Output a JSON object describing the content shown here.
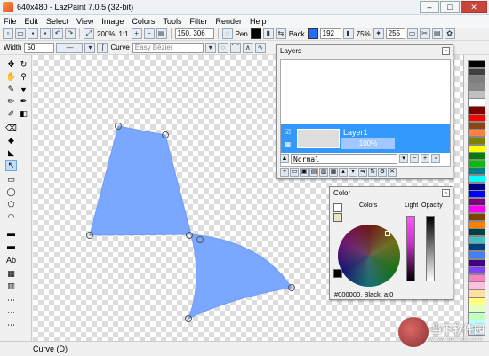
{
  "window": {
    "title": "640x480 - LazPaint 7.0.5 (32-bit)"
  },
  "menu": [
    "File",
    "Edit",
    "Select",
    "View",
    "Image",
    "Colors",
    "Tools",
    "Filter",
    "Render",
    "Help"
  ],
  "toolbar1": {
    "zoom": "200%",
    "zoom_reset": "1:1",
    "coords": "150, 306",
    "pen_label": "Pen",
    "back_label": "Back",
    "back_value": "192",
    "percent": "75%",
    "tolerance_value": "255"
  },
  "toolbar2": {
    "width_label": "Width",
    "width_value": "50",
    "curve_label": "Curve",
    "spline_style": "Easy Bézier"
  },
  "colors": {
    "pen": "#000000",
    "back": "#1e6fff",
    "shape_fill": "#7aa7ff"
  },
  "layers": {
    "title": "Layers",
    "layer_name": "Layer1",
    "layer_opacity": "100%",
    "blend_mode": "Normal"
  },
  "color_panel": {
    "title": "Color",
    "colors_label": "Colors",
    "light_label": "Light",
    "opacity_label": "Opacity",
    "readout": "#000000, Black, a:0"
  },
  "palette": [
    "#000000",
    "#404040",
    "#7f7f7f",
    "#888888",
    "#c0c0c0",
    "#ffffff",
    "#800000",
    "#ff0000",
    "#8b4513",
    "#ff8040",
    "#808000",
    "#ffff00",
    "#008000",
    "#00c000",
    "#008080",
    "#00ffff",
    "#000080",
    "#0000ff",
    "#800080",
    "#ff00ff",
    "#804000",
    "#ff8000",
    "#004040",
    "#40c0c0",
    "#004080",
    "#4080ff",
    "#400080",
    "#8040ff",
    "#ff80c0",
    "#ffc0e0",
    "#ffe0a0",
    "#ffff80",
    "#e0ffc0",
    "#c0ffc0",
    "#c0ffff",
    "#c0e0ff"
  ],
  "status": {
    "text": "Curve (D)"
  },
  "watermark": {
    "big": "当下软件园",
    "small": "www.downxia.com"
  }
}
